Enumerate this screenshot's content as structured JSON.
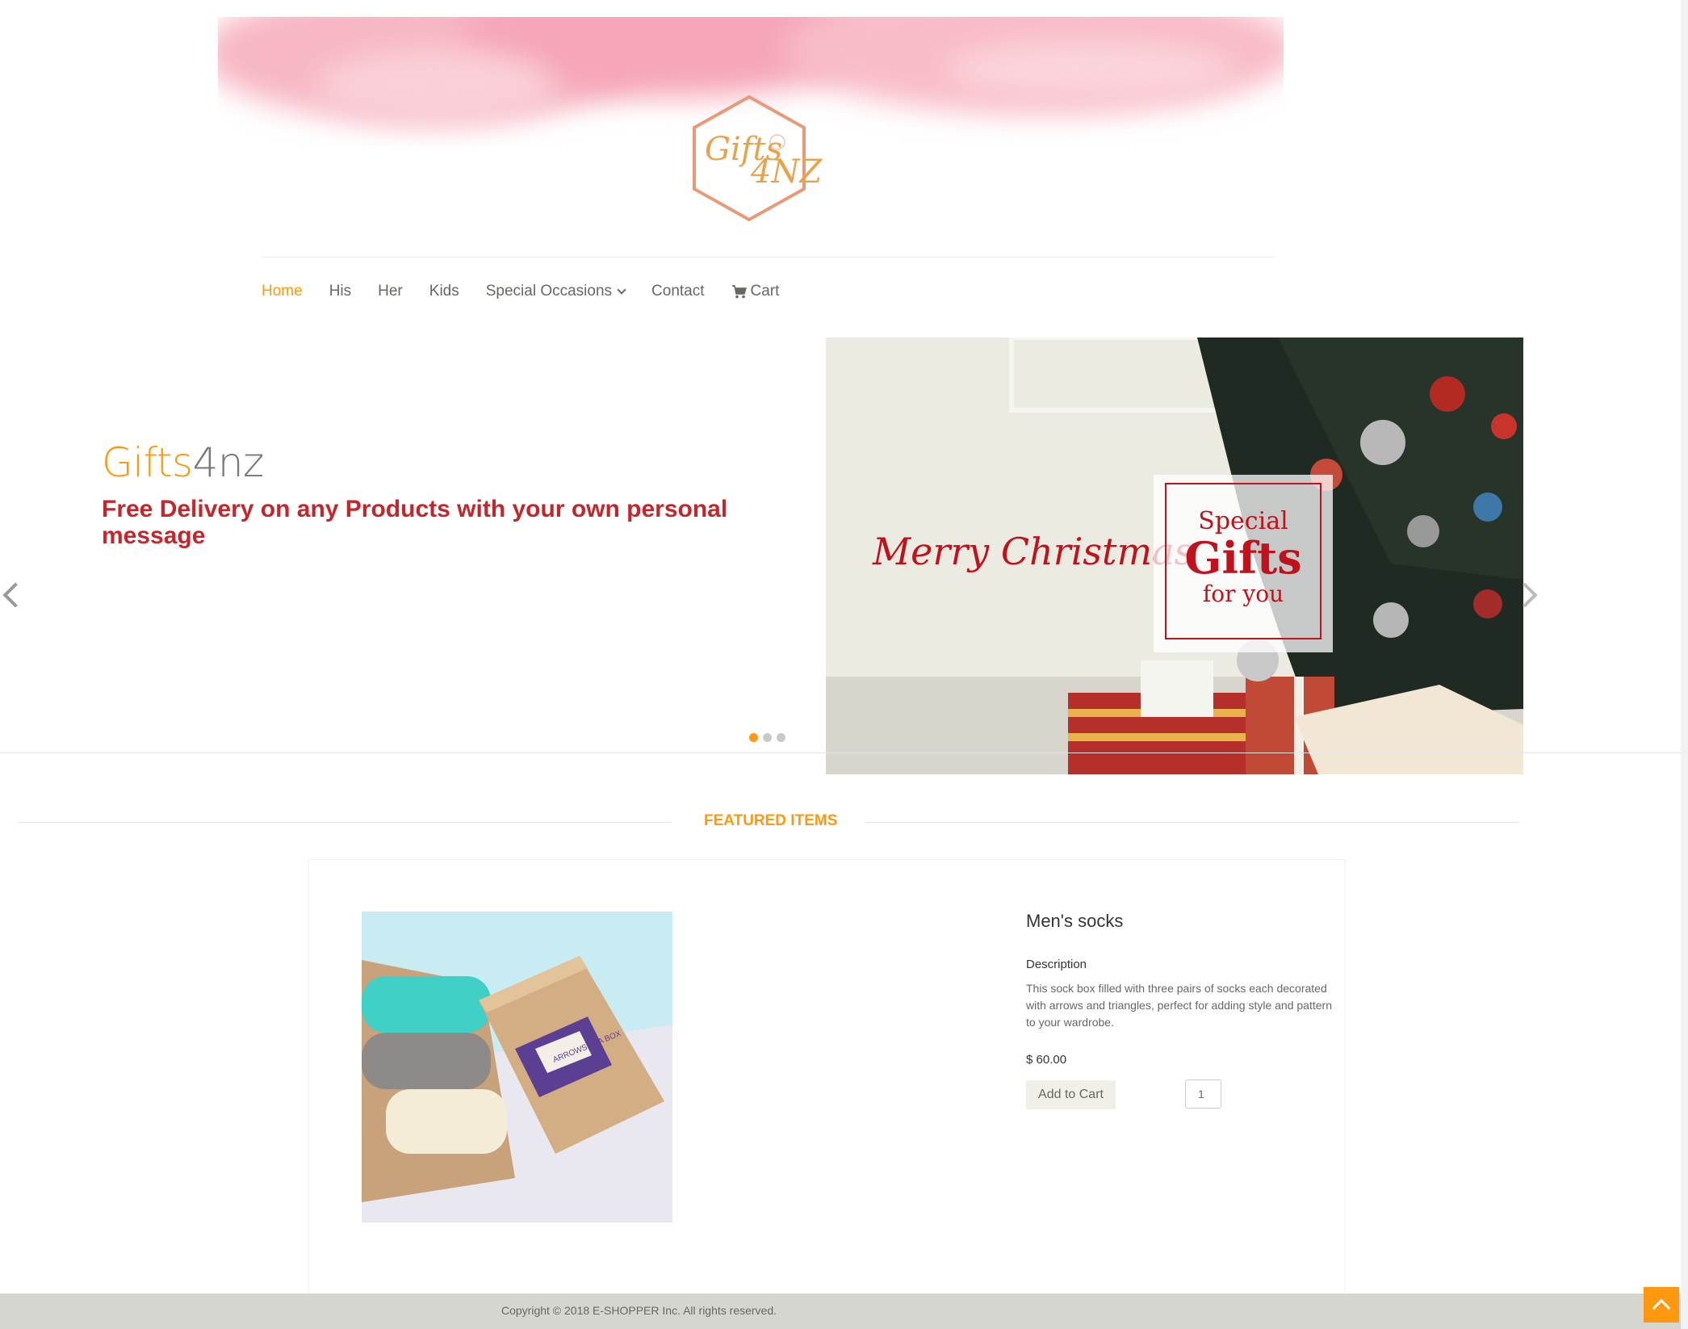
{
  "logo": {
    "line1": "Gifts",
    "line2": "4NZ"
  },
  "nav": {
    "items": [
      {
        "label": "Home"
      },
      {
        "label": "His"
      },
      {
        "label": "Her"
      },
      {
        "label": "Kids"
      },
      {
        "label": "Special Occasions"
      },
      {
        "label": "Contact"
      },
      {
        "label": "Cart"
      }
    ],
    "active": "Home"
  },
  "slider": {
    "brand_part1": "Gifts",
    "brand_part2": "4nz",
    "subtitle": "Free Delivery on any Products with your own personal message",
    "image_text": {
      "left": "Merry Christmas",
      "box_line1": "Special",
      "box_line2": "Gifts",
      "box_line3": "for you"
    },
    "dots": 3,
    "active_dot": 1
  },
  "featured": {
    "title": "FEATURED ITEMS",
    "product": {
      "name": "Men's socks",
      "description_label": "Description",
      "description": "This sock box filled with three pairs of socks each decorated with arrows and triangles, perfect for adding style and pattern to your wardrobe.",
      "price": "$ 60.00",
      "add_to_cart": "Add to Cart",
      "quantity": "1",
      "box_label": "ARROWS IN A BOX"
    }
  },
  "footer": {
    "copyright": "Copyright © 2018 E-SHOPPER Inc. All rights reserved."
  },
  "colors": {
    "accent": "#fe980f",
    "subtitle_red": "#c3262b",
    "logo_peach": "#e89a78",
    "footer_bg": "#d6d6d0"
  },
  "icons": [
    "cart-icon",
    "chevron-down-icon",
    "chevron-left-icon",
    "chevron-right-icon",
    "arrow-up-icon"
  ]
}
